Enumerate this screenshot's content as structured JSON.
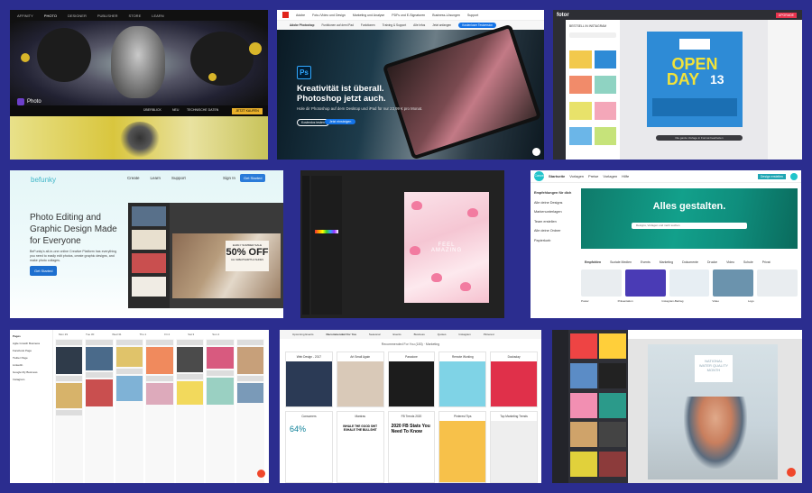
{
  "tiles": {
    "affinity": {
      "nav": [
        "AFFINITY",
        "PHOTO",
        "DESIGNER",
        "PUBLISHER",
        "STORE",
        "LEARN"
      ],
      "logo": "Photo",
      "subnav": [
        "ÜBERBLICK",
        "NEU",
        "TECHNISCHE DATEN"
      ],
      "cta": "JETZT KAUFEN"
    },
    "adobe": {
      "brand": "Adobe",
      "nav": [
        "Foto-/Video und Design",
        "Marketing und Analyse",
        "PDFs und E-Signaturen",
        "Business-Lösungen",
        "Support"
      ],
      "subnav": [
        "Adobe Photoshop",
        "Funktionen auf dem iPad",
        "Funktionen",
        "Training & Support",
        "Alle Infos",
        "Jetzt anfangen"
      ],
      "subnav_button": "Kostenloser Testversion",
      "app_icon": "Ps",
      "headline_1": "Kreativität ist überall.",
      "headline_2": "Photoshop jetzt auch.",
      "subline": "Hole dir Photoshop auf dem Desktop und iPad für nur 23,99 € pro Monat.",
      "btn_secondary": "Kostenlos testen",
      "btn_primary": "Jetzt einsteigen"
    },
    "fotor": {
      "logo": "fotor",
      "upgrade": "UPGRADE",
      "panel_title": "BESTSELL IN INSTAGRAM",
      "poster_line_1": "OPEN",
      "poster_line_2": "DAY",
      "poster_number": "13",
      "bottom_bar": "Die ganze Vorlage in Format bearbeiten"
    },
    "befunky": {
      "logo": "befunky",
      "nav": [
        "Create",
        "Learn",
        "Support"
      ],
      "signin": "Sign In",
      "get_started": "Get Started",
      "headline_1": "Photo Editing and",
      "headline_2": "Graphic Design Made",
      "headline_3": "for Everyone",
      "body": "BeFunky's all-in-one online Creative Platform has everything you need to easily edit photos, create graphic designs, and make photo collages.",
      "cta": "Get Started",
      "sale_top": "EARLY SUMMER SALE",
      "sale_big": "50% OFF",
      "sale_bottom": "ALL SWEATSHIRTS & SHOES"
    },
    "doc_editor": {
      "doc_text_1": "FEEL",
      "doc_text_2": "AMAZING"
    },
    "canva": {
      "logo": "Canva",
      "nav": [
        "Startseite",
        "Vorlagen",
        "Preise",
        "Vorlagen",
        "Hilfe"
      ],
      "cta": "Design erstellen",
      "side": [
        "Empfehlungen für dich",
        "Alle deine Designs",
        "Markenunterlagen",
        "Team erstellen",
        "Alle deine Ordner",
        "Papierkorb"
      ],
      "hero": "Alles gestalten.",
      "search_placeholder": "Designs, Vorlagen und mehr suchen",
      "categories": [
        "Empfohlen",
        "Soziale Medien",
        "Events",
        "Marketing",
        "Dokumente",
        "Drucke",
        "Video",
        "Schule",
        "Privat"
      ],
      "cards": [
        "Poster",
        "Präsentation",
        "Instagram-Beitrag",
        "Video",
        "Logo"
      ]
    },
    "planner": {
      "title": "Pages",
      "side": [
        "Agile Growth Business",
        "Facebook Page",
        "Twitter Page",
        "LinkedIn",
        "Google My Business",
        "Instagram"
      ],
      "days": [
        "Mon 29",
        "Tue 30",
        "Wed 31",
        "Thu 1",
        "Fri 2",
        "Sat 3",
        "Sun 4"
      ]
    },
    "marketing": {
      "tabs": [
        "Upcoming Events",
        "Recommended For You",
        "Seasonal",
        "Events",
        "Business",
        "Quotes",
        "Instagram",
        "Pinterest"
      ],
      "heading": "Recommended For You (183) · Marketing",
      "cards": [
        "Web Design - 2017",
        "Art Small Again",
        "Paradoxe",
        "Remote Working",
        "Docksday",
        "Consumers",
        "Mantras",
        "FB Trends 2020",
        "Pinterest Tips",
        "Top Marketing Trends"
      ],
      "quote": "INHALE THE GOOD SHIT EXHALE THE BULLSHIT",
      "fb_trends": "2020 FB Stats You Need To Know",
      "stat": "64%"
    },
    "designer": {
      "banner_1": "NATIONAL",
      "banner_2": "WATER QUALITY",
      "banner_3": "MONTH"
    }
  }
}
